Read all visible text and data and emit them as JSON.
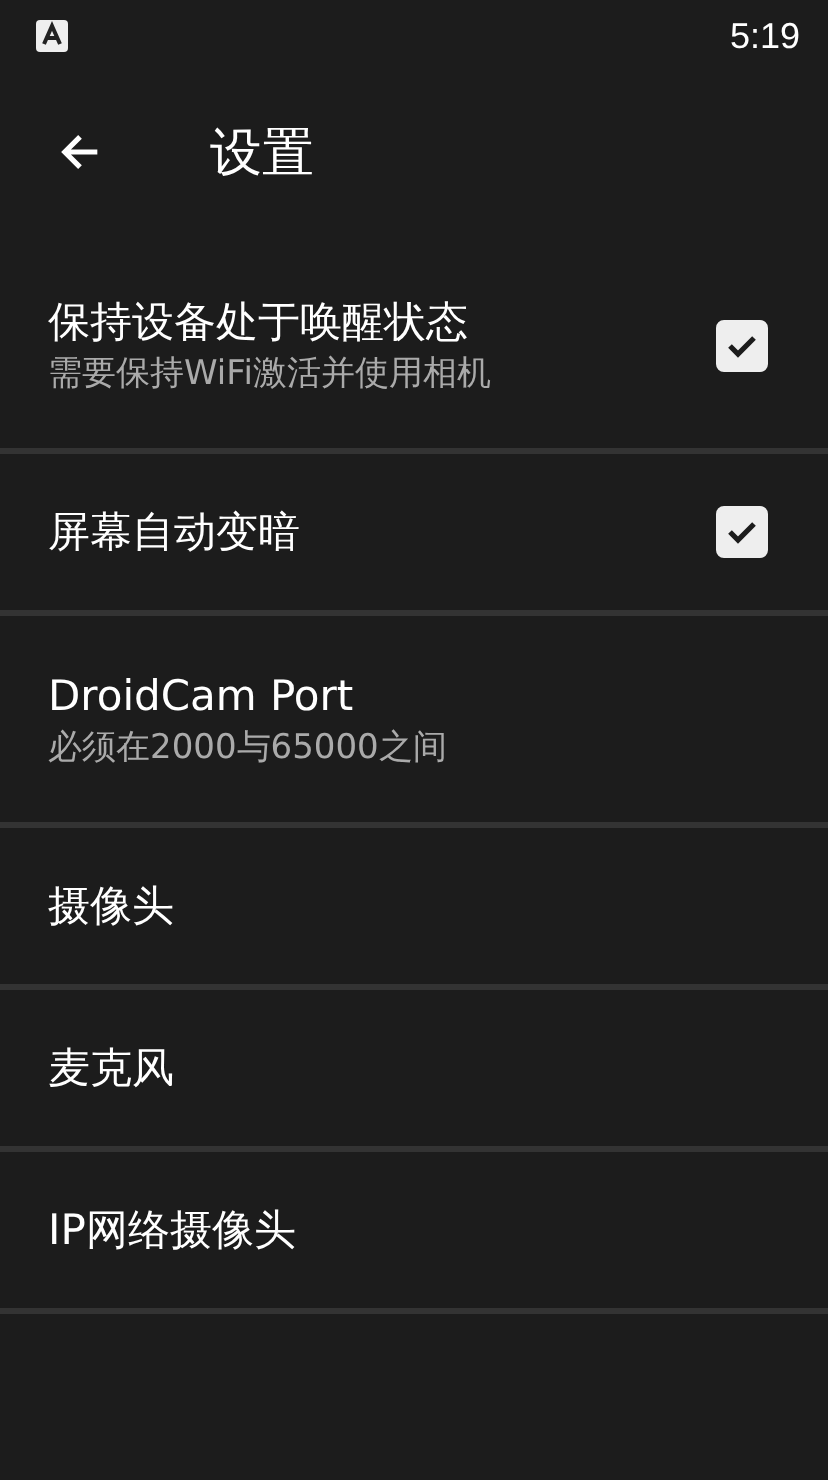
{
  "status_bar": {
    "time": "5:19"
  },
  "toolbar": {
    "title": "设置"
  },
  "settings": [
    {
      "kind": "checkbox",
      "title": "保持设备处于唤醒状态",
      "summary": "需要保持WiFi激活并使用相机",
      "checked": true
    },
    {
      "kind": "checkbox",
      "title": "屏幕自动变暗",
      "checked": true
    },
    {
      "kind": "plain",
      "title": "DroidCam Port",
      "summary": "必须在2000与65000之间"
    },
    {
      "kind": "plain",
      "title": "摄像头"
    },
    {
      "kind": "plain",
      "title": "麦克风"
    },
    {
      "kind": "plain",
      "title": "IP网络摄像头"
    }
  ]
}
